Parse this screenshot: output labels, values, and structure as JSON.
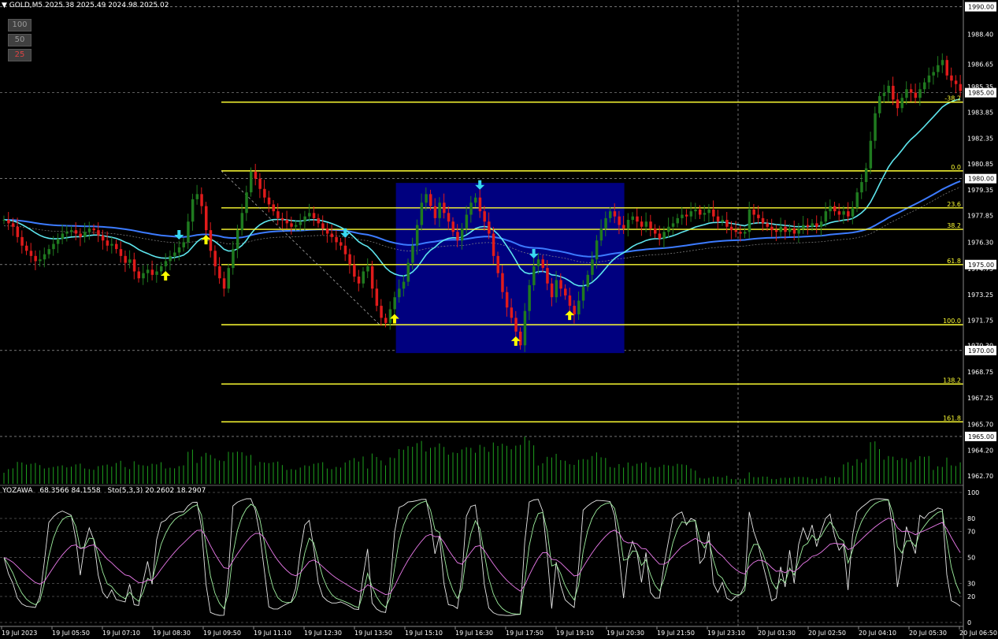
{
  "header": {
    "symbol": "GOLD,M5",
    "ohlc": "2025.38 2025.49 2024.98 2025.02"
  },
  "zoom_buttons": [
    {
      "label": "100",
      "active": false
    },
    {
      "label": "50",
      "active": false
    },
    {
      "label": "25",
      "active": true
    }
  ],
  "indicator": {
    "name": "YOZAWA",
    "values": "68.3566 84.1558",
    "stoch": "Sto(5,3,3) 20.2602 18.2907"
  },
  "colors": {
    "bg": "#000000",
    "up": "#1f7a1f",
    "down": "#e01b1b",
    "fib": "#ffff33",
    "box": "#00007f",
    "ma_fast": "#5ee6ee",
    "ma_slow": "#3c7bff",
    "volume": "#1ea01e",
    "arrow_up": "#ffff00",
    "arrow_down": "#38d8f0"
  },
  "chart_data": {
    "type": "candlestick",
    "price_axis": {
      "ticks": [
        "1988.40",
        "1986.65",
        "1985.35",
        "1983.85",
        "1982.35",
        "1980.85",
        "1979.35",
        "1977.85",
        "1976.30",
        "1974.75",
        "1973.25",
        "1971.75",
        "1970.30",
        "1968.75",
        "1967.25",
        "1965.70",
        "1964.20",
        "1962.70"
      ],
      "tick_values": [
        1988.4,
        1986.65,
        1985.35,
        1983.85,
        1982.35,
        1980.85,
        1979.35,
        1977.85,
        1976.3,
        1974.75,
        1973.25,
        1971.75,
        1970.3,
        1968.75,
        1967.25,
        1965.7,
        1964.2,
        1962.7
      ],
      "boxed_labels": [
        "1990.00",
        "1985.00",
        "1980.00",
        "1975.00",
        "1970.00",
        "1965.00"
      ],
      "boxed_values": [
        1990.0,
        1985.0,
        1980.0,
        1975.0,
        1970.0,
        1965.0
      ],
      "range": [
        1962.2,
        1990.3
      ]
    },
    "time_axis": [
      "19 Jul 2023",
      "19 Jul 05:50",
      "19 Jul 07:10",
      "19 Jul 08:30",
      "19 Jul 09:50",
      "19 Jul 11:10",
      "19 Jul 12:30",
      "19 Jul 13:50",
      "19 Jul 15:10",
      "19 Jul 16:30",
      "19 Jul 17:50",
      "19 Jul 19:10",
      "19 Jul 20:30",
      "19 Jul 21:50",
      "19 Jul 23:10",
      "20 Jul 01:30",
      "20 Jul 02:50",
      "20 Jul 04:10",
      "20 Jul 05:30",
      "20 Jul 06:50"
    ],
    "fibonacci": [
      {
        "label": "-38.2",
        "price": 1984.45
      },
      {
        "label": "0.0",
        "price": 1980.45
      },
      {
        "label": "23.6",
        "price": 1978.3
      },
      {
        "label": "38.2",
        "price": 1977.05
      },
      {
        "label": "61.8",
        "price": 1975.0
      },
      {
        "label": "100.0",
        "price": 1971.5
      },
      {
        "label": "138.2",
        "price": 1968.05
      },
      {
        "label": "161.8",
        "price": 1965.85
      }
    ],
    "box": {
      "price_high": 1979.75,
      "price_low": 1969.85
    },
    "closes": [
      1977.6,
      1977.4,
      1977.2,
      1976.6,
      1976.1,
      1975.8,
      1975.5,
      1975.2,
      1975.3,
      1975.6,
      1975.9,
      1976.2,
      1976.5,
      1976.8,
      1976.9,
      1977.0,
      1976.8,
      1976.6,
      1976.9,
      1977.1,
      1977.0,
      1976.7,
      1976.4,
      1976.1,
      1976.2,
      1975.9,
      1975.5,
      1975.1,
      1975.3,
      1974.6,
      1974.2,
      1974.5,
      1974.7,
      1974.4,
      1974.6,
      1974.9,
      1975.2,
      1975.5,
      1975.7,
      1976.0,
      1976.3,
      1977.5,
      1978.8,
      1979.1,
      1978.4,
      1977.0,
      1975.8,
      1974.9,
      1974.2,
      1973.6,
      1974.8,
      1975.9,
      1977.0,
      1978.0,
      1979.2,
      1980.4,
      1980.0,
      1979.4,
      1978.9,
      1978.5,
      1978.1,
      1977.7,
      1977.6,
      1977.4,
      1977.2,
      1977.3,
      1977.5,
      1977.8,
      1978.0,
      1977.7,
      1977.4,
      1977.1,
      1976.8,
      1976.6,
      1976.3,
      1976.1,
      1975.6,
      1975.0,
      1974.3,
      1973.9,
      1974.6,
      1974.9,
      1973.6,
      1972.6,
      1971.9,
      1971.6,
      1972.4,
      1973.1,
      1973.6,
      1974.0,
      1975.1,
      1976.1,
      1977.3,
      1978.6,
      1979.1,
      1978.4,
      1977.7,
      1978.6,
      1978.0,
      1977.5,
      1976.9,
      1976.4,
      1977.1,
      1977.9,
      1978.6,
      1978.9,
      1978.1,
      1977.5,
      1976.8,
      1975.5,
      1974.5,
      1973.4,
      1972.5,
      1971.9,
      1971.1,
      1970.3,
      1972.3,
      1973.8,
      1974.9,
      1975.3,
      1974.8,
      1973.9,
      1973.1,
      1974.1,
      1973.6,
      1973.2,
      1972.6,
      1972.1,
      1972.9,
      1973.7,
      1974.4,
      1975.3,
      1976.4,
      1977.1,
      1977.7,
      1978.1,
      1977.8,
      1977.3,
      1977.1,
      1977.6,
      1977.8,
      1977.5,
      1977.2,
      1977.5,
      1977.1,
      1976.8,
      1976.5,
      1976.9,
      1977.2,
      1977.4,
      1977.7,
      1977.9,
      1977.8,
      1978.1,
      1978.2,
      1977.9,
      1978.0,
      1978.2,
      1977.8,
      1977.5,
      1977.6,
      1977.2,
      1977.0,
      1976.9,
      1976.8,
      1976.9,
      1978.2,
      1977.9,
      1977.7,
      1977.4,
      1977.2,
      1977.0,
      1976.9,
      1977.2,
      1976.9,
      1977.1,
      1976.8,
      1977.1,
      1977.3,
      1977.2,
      1977.4,
      1977.2,
      1977.5,
      1978.1,
      1978.4,
      1978.1,
      1977.9,
      1978.1,
      1977.8,
      1978.3,
      1979.2,
      1979.8,
      1980.6,
      1982.2,
      1983.8,
      1984.8,
      1985.0,
      1985.4,
      1984.6,
      1984.1,
      1984.7,
      1985.2,
      1985.0,
      1984.7,
      1985.2,
      1985.6,
      1986.0,
      1986.2,
      1986.6,
      1986.9,
      1986.0,
      1985.7,
      1985.5,
      1985.1
    ]
  },
  "stochastic": {
    "levels": [
      {
        "label": "100",
        "value": 100
      },
      {
        "label": "80",
        "value": 80
      },
      {
        "label": "70",
        "value": 70
      },
      {
        "label": "50",
        "value": 50
      },
      {
        "label": "30",
        "value": 30
      },
      {
        "label": "20",
        "value": 20
      },
      {
        "label": "0",
        "value": 0
      }
    ]
  }
}
